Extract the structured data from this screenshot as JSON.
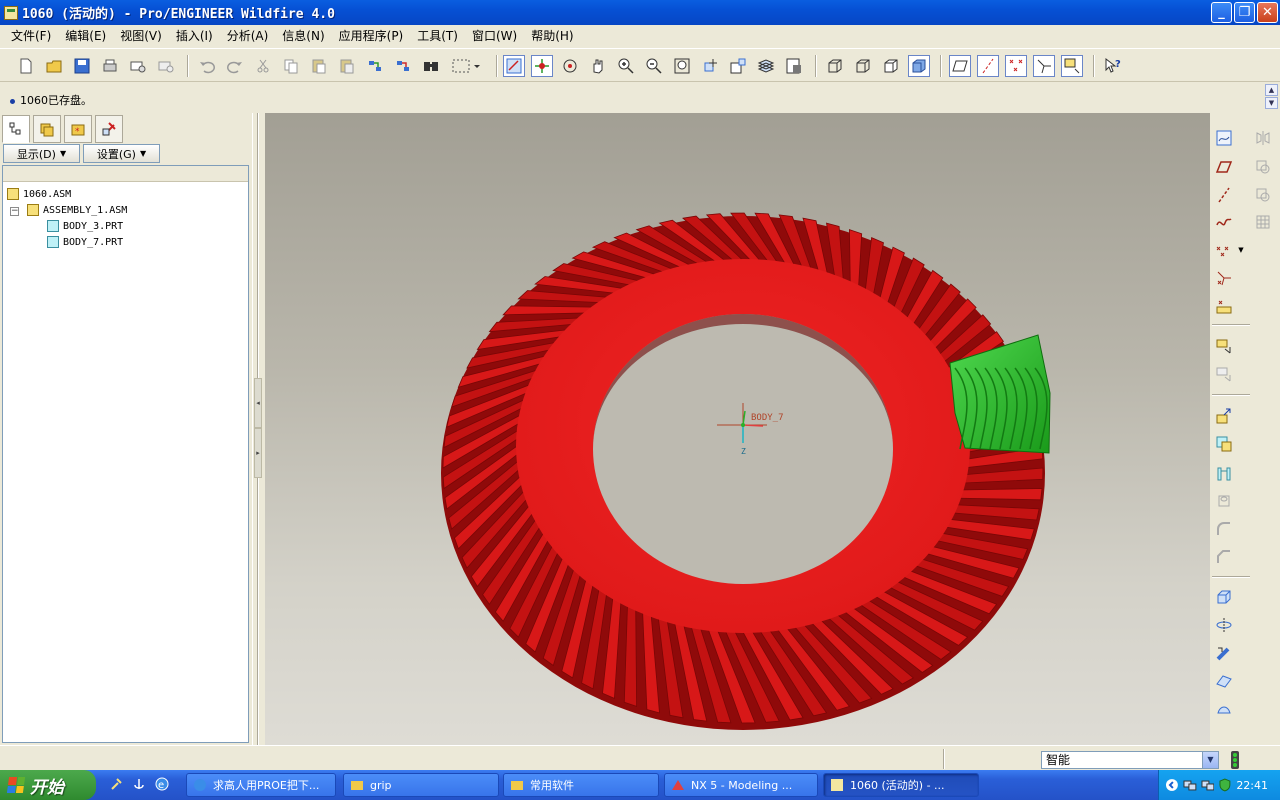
{
  "window": {
    "title": "1060 (活动的) - Pro/ENGINEER Wildfire 4.0"
  },
  "menu": [
    "文件(F)",
    "编辑(E)",
    "视图(V)",
    "插入(I)",
    "分析(A)",
    "信息(N)",
    "应用程序(P)",
    "工具(T)",
    "窗口(W)",
    "帮助(H)"
  ],
  "message": "1060已存盘。",
  "navigator": {
    "display_btn": "显示(D)",
    "settings_btn": "设置(G)",
    "tree": [
      {
        "label": "1060.ASM",
        "type": "asm",
        "level": 0
      },
      {
        "label": "ASSEMBLY_1.ASM",
        "type": "asm",
        "level": 1
      },
      {
        "label": "BODY_3.PRT",
        "type": "prt",
        "level": 2
      },
      {
        "label": "BODY_7.PRT",
        "type": "prt",
        "level": 2
      }
    ]
  },
  "viewport": {
    "csys_label": "BODY_7",
    "axis_z": "Z",
    "gear_color": "#e01a1a",
    "pinion_color": "#22b022",
    "background_top": "#a29f94",
    "background_bottom": "#dedcd5"
  },
  "status": {
    "filter_value": "智能"
  },
  "taskbar": {
    "start_label": "开始",
    "tasks": [
      "求高人用PROE把下...",
      "grip",
      "常用软件",
      "NX 5 - Modeling ...",
      "1060 (活动的) - ..."
    ],
    "clock": "22:41"
  }
}
